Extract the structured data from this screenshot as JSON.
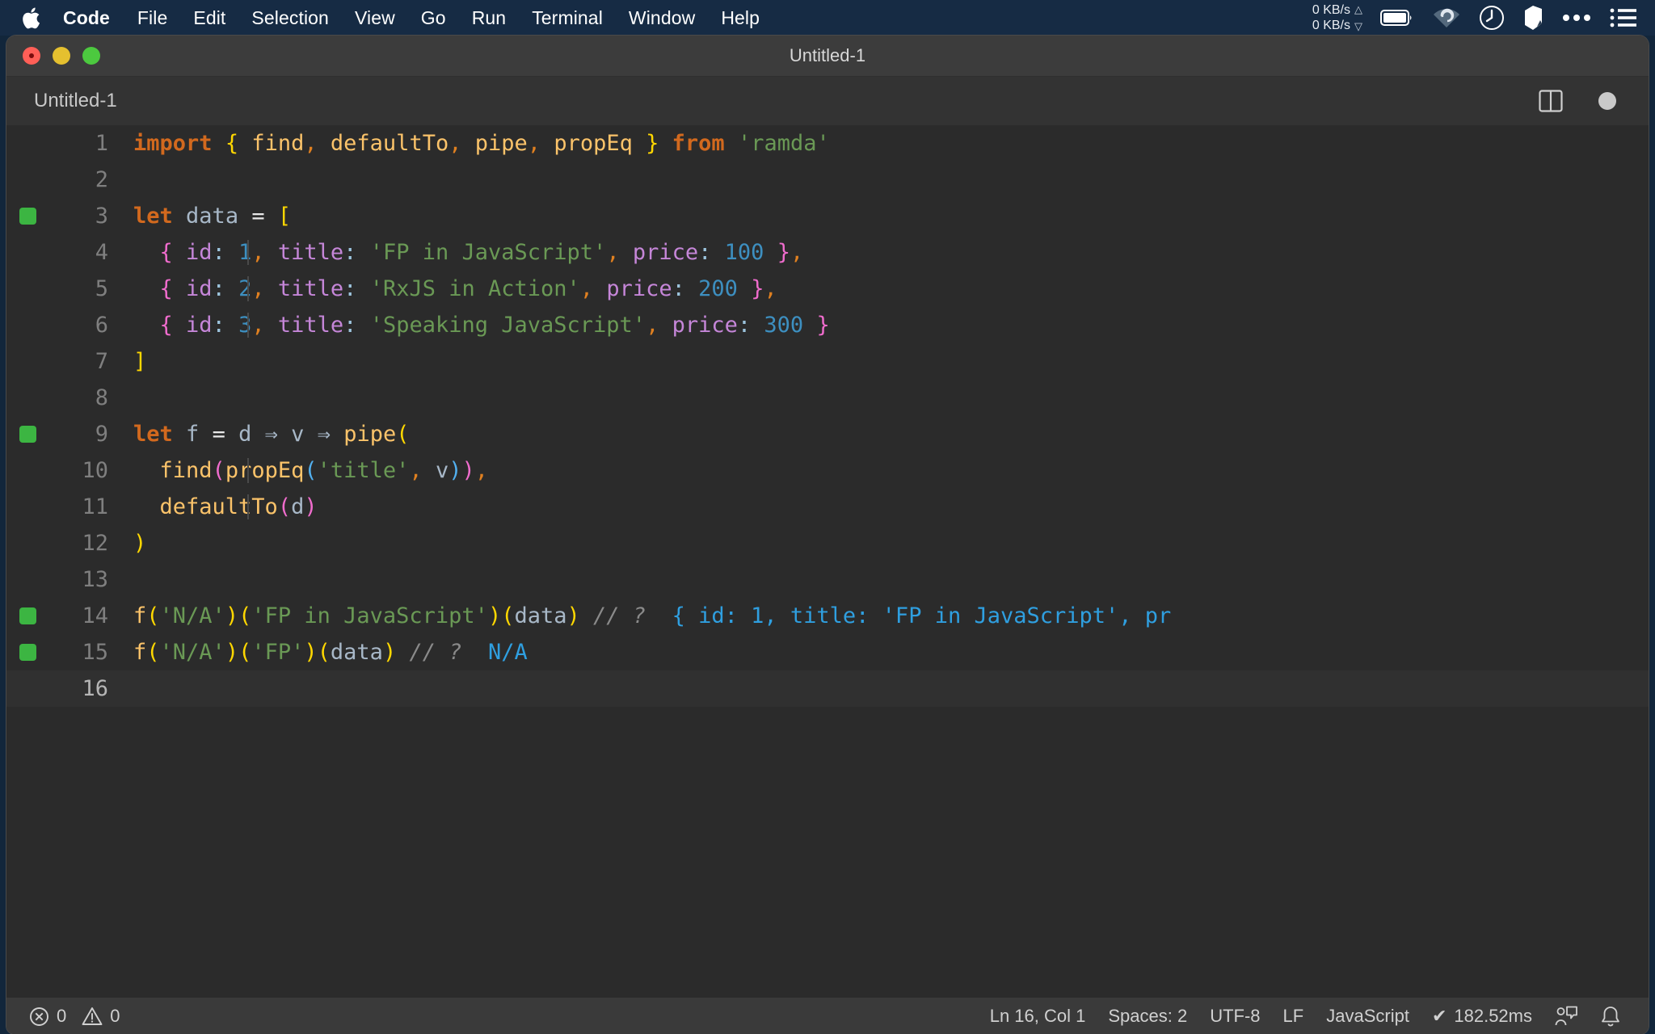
{
  "menubar": {
    "apple_icon": "apple-logo",
    "items": [
      {
        "label": "Code",
        "bold": true
      },
      {
        "label": "File",
        "bold": false
      },
      {
        "label": "Edit",
        "bold": false
      },
      {
        "label": "Selection",
        "bold": false
      },
      {
        "label": "View",
        "bold": false
      },
      {
        "label": "Go",
        "bold": false
      },
      {
        "label": "Run",
        "bold": false
      },
      {
        "label": "Terminal",
        "bold": false
      },
      {
        "label": "Window",
        "bold": false
      },
      {
        "label": "Help",
        "bold": false
      }
    ],
    "network": {
      "upload": "0 KB/s",
      "download": "0 KB/s"
    },
    "status_icons": [
      "battery-icon",
      "wifi-icon",
      "clock-icon",
      "bartender-icon",
      "ellipsis-icon",
      "list-icon"
    ]
  },
  "window": {
    "title": "Untitled-1",
    "traffic_lights": [
      "close-button",
      "minimize-button",
      "maximize-button"
    ]
  },
  "tabbar": {
    "tabs": [
      {
        "label": "Untitled-1",
        "active": true
      }
    ],
    "actions": [
      "split-editor-icon",
      "unsaved-dot-icon"
    ]
  },
  "editor": {
    "language": "JavaScript",
    "current_line": 16,
    "lines": [
      {
        "n": 1,
        "breakpoint": false,
        "indent_guide": false,
        "current": false
      },
      {
        "n": 2,
        "breakpoint": false,
        "indent_guide": false,
        "current": false
      },
      {
        "n": 3,
        "breakpoint": true,
        "indent_guide": false,
        "current": false
      },
      {
        "n": 4,
        "breakpoint": false,
        "indent_guide": true,
        "current": false
      },
      {
        "n": 5,
        "breakpoint": false,
        "indent_guide": true,
        "current": false
      },
      {
        "n": 6,
        "breakpoint": false,
        "indent_guide": true,
        "current": false
      },
      {
        "n": 7,
        "breakpoint": false,
        "indent_guide": false,
        "current": false
      },
      {
        "n": 8,
        "breakpoint": false,
        "indent_guide": false,
        "current": false
      },
      {
        "n": 9,
        "breakpoint": true,
        "indent_guide": false,
        "current": false
      },
      {
        "n": 10,
        "breakpoint": false,
        "indent_guide": true,
        "current": false
      },
      {
        "n": 11,
        "breakpoint": false,
        "indent_guide": true,
        "current": false
      },
      {
        "n": 12,
        "breakpoint": false,
        "indent_guide": false,
        "current": false
      },
      {
        "n": 13,
        "breakpoint": false,
        "indent_guide": false,
        "current": false
      },
      {
        "n": 14,
        "breakpoint": true,
        "indent_guide": false,
        "current": false
      },
      {
        "n": 15,
        "breakpoint": true,
        "indent_guide": false,
        "current": false
      },
      {
        "n": 16,
        "breakpoint": false,
        "indent_guide": false,
        "current": true
      }
    ],
    "source_text": [
      "import { find, defaultTo, pipe, propEq } from 'ramda'",
      "",
      "let data = [",
      "  { id: 1, title: 'FP in JavaScript', price: 100 },",
      "  { id: 2, title: 'RxJS in Action', price: 200 },",
      "  { id: 3, title: 'Speaking JavaScript', price: 300 }",
      "]",
      "",
      "let f = d => v => pipe(",
      "  find(propEq('title', v)),",
      "  defaultTo(d)",
      ")",
      "",
      "f('N/A')('FP in JavaScript')(data) // ? { id: 1, title: 'FP in JavaScript', pr",
      "f('N/A')('FP')(data) // ? N/A",
      ""
    ],
    "tokens": {
      "l1": [
        {
          "t": "import",
          "c": "kw"
        },
        {
          "t": " ",
          "c": "plain"
        },
        {
          "t": "{",
          "c": "br1"
        },
        {
          "t": " ",
          "c": "plain"
        },
        {
          "t": "find",
          "c": "fn"
        },
        {
          "t": ",",
          "c": "comma"
        },
        {
          "t": " ",
          "c": "plain"
        },
        {
          "t": "defaultTo",
          "c": "fn"
        },
        {
          "t": ",",
          "c": "comma"
        },
        {
          "t": " ",
          "c": "plain"
        },
        {
          "t": "pipe",
          "c": "fn"
        },
        {
          "t": ",",
          "c": "comma"
        },
        {
          "t": " ",
          "c": "plain"
        },
        {
          "t": "propEq",
          "c": "fn"
        },
        {
          "t": " ",
          "c": "plain"
        },
        {
          "t": "}",
          "c": "br1"
        },
        {
          "t": " ",
          "c": "plain"
        },
        {
          "t": "from",
          "c": "kw"
        },
        {
          "t": " ",
          "c": "plain"
        },
        {
          "t": "'ramda'",
          "c": "str"
        }
      ],
      "l3": [
        {
          "t": "let",
          "c": "kw"
        },
        {
          "t": " ",
          "c": "plain"
        },
        {
          "t": "data",
          "c": "var"
        },
        {
          "t": " ",
          "c": "plain"
        },
        {
          "t": "=",
          "c": "op"
        },
        {
          "t": " ",
          "c": "plain"
        },
        {
          "t": "[",
          "c": "br1"
        }
      ],
      "l4": [
        {
          "t": "  ",
          "c": "plain"
        },
        {
          "t": "{",
          "c": "br2"
        },
        {
          "t": " ",
          "c": "plain"
        },
        {
          "t": "id",
          "c": "prop"
        },
        {
          "t": ":",
          "c": "colon"
        },
        {
          "t": " ",
          "c": "plain"
        },
        {
          "t": "1",
          "c": "num"
        },
        {
          "t": ",",
          "c": "comma"
        },
        {
          "t": " ",
          "c": "plain"
        },
        {
          "t": "title",
          "c": "prop"
        },
        {
          "t": ":",
          "c": "colon"
        },
        {
          "t": " ",
          "c": "plain"
        },
        {
          "t": "'FP in JavaScript'",
          "c": "str"
        },
        {
          "t": ",",
          "c": "comma"
        },
        {
          "t": " ",
          "c": "plain"
        },
        {
          "t": "price",
          "c": "prop"
        },
        {
          "t": ":",
          "c": "colon"
        },
        {
          "t": " ",
          "c": "plain"
        },
        {
          "t": "100",
          "c": "num"
        },
        {
          "t": " ",
          "c": "plain"
        },
        {
          "t": "}",
          "c": "br2"
        },
        {
          "t": ",",
          "c": "comma"
        }
      ],
      "l5": [
        {
          "t": "  ",
          "c": "plain"
        },
        {
          "t": "{",
          "c": "br2"
        },
        {
          "t": " ",
          "c": "plain"
        },
        {
          "t": "id",
          "c": "prop"
        },
        {
          "t": ":",
          "c": "colon"
        },
        {
          "t": " ",
          "c": "plain"
        },
        {
          "t": "2",
          "c": "num"
        },
        {
          "t": ",",
          "c": "comma"
        },
        {
          "t": " ",
          "c": "plain"
        },
        {
          "t": "title",
          "c": "prop"
        },
        {
          "t": ":",
          "c": "colon"
        },
        {
          "t": " ",
          "c": "plain"
        },
        {
          "t": "'RxJS in Action'",
          "c": "str"
        },
        {
          "t": ",",
          "c": "comma"
        },
        {
          "t": " ",
          "c": "plain"
        },
        {
          "t": "price",
          "c": "prop"
        },
        {
          "t": ":",
          "c": "colon"
        },
        {
          "t": " ",
          "c": "plain"
        },
        {
          "t": "200",
          "c": "num"
        },
        {
          "t": " ",
          "c": "plain"
        },
        {
          "t": "}",
          "c": "br2"
        },
        {
          "t": ",",
          "c": "comma"
        }
      ],
      "l6": [
        {
          "t": "  ",
          "c": "plain"
        },
        {
          "t": "{",
          "c": "br2"
        },
        {
          "t": " ",
          "c": "plain"
        },
        {
          "t": "id",
          "c": "prop"
        },
        {
          "t": ":",
          "c": "colon"
        },
        {
          "t": " ",
          "c": "plain"
        },
        {
          "t": "3",
          "c": "num"
        },
        {
          "t": ",",
          "c": "comma"
        },
        {
          "t": " ",
          "c": "plain"
        },
        {
          "t": "title",
          "c": "prop"
        },
        {
          "t": ":",
          "c": "colon"
        },
        {
          "t": " ",
          "c": "plain"
        },
        {
          "t": "'Speaking JavaScript'",
          "c": "str"
        },
        {
          "t": ",",
          "c": "comma"
        },
        {
          "t": " ",
          "c": "plain"
        },
        {
          "t": "price",
          "c": "prop"
        },
        {
          "t": ":",
          "c": "colon"
        },
        {
          "t": " ",
          "c": "plain"
        },
        {
          "t": "300",
          "c": "num"
        },
        {
          "t": " ",
          "c": "plain"
        },
        {
          "t": "}",
          "c": "br2"
        }
      ],
      "l7": [
        {
          "t": "]",
          "c": "br1"
        }
      ],
      "l9": [
        {
          "t": "let",
          "c": "kw"
        },
        {
          "t": " ",
          "c": "plain"
        },
        {
          "t": "f",
          "c": "var"
        },
        {
          "t": " ",
          "c": "plain"
        },
        {
          "t": "=",
          "c": "op"
        },
        {
          "t": " ",
          "c": "plain"
        },
        {
          "t": "d",
          "c": "var"
        },
        {
          "t": " ",
          "c": "plain"
        },
        {
          "t": "⇒",
          "c": "arrow"
        },
        {
          "t": " ",
          "c": "plain"
        },
        {
          "t": "v",
          "c": "var"
        },
        {
          "t": " ",
          "c": "plain"
        },
        {
          "t": "⇒",
          "c": "arrow"
        },
        {
          "t": " ",
          "c": "plain"
        },
        {
          "t": "pipe",
          "c": "fn"
        },
        {
          "t": "(",
          "c": "br1"
        }
      ],
      "l10": [
        {
          "t": "  ",
          "c": "plain"
        },
        {
          "t": "find",
          "c": "fn"
        },
        {
          "t": "(",
          "c": "br2"
        },
        {
          "t": "propEq",
          "c": "fn"
        },
        {
          "t": "(",
          "c": "br3"
        },
        {
          "t": "'title'",
          "c": "str"
        },
        {
          "t": ",",
          "c": "comma"
        },
        {
          "t": " ",
          "c": "plain"
        },
        {
          "t": "v",
          "c": "var"
        },
        {
          "t": ")",
          "c": "br3"
        },
        {
          "t": ")",
          "c": "br2"
        },
        {
          "t": ",",
          "c": "comma"
        }
      ],
      "l11": [
        {
          "t": "  ",
          "c": "plain"
        },
        {
          "t": "defaultTo",
          "c": "fn"
        },
        {
          "t": "(",
          "c": "br2"
        },
        {
          "t": "d",
          "c": "var"
        },
        {
          "t": ")",
          "c": "br2"
        }
      ],
      "l12": [
        {
          "t": ")",
          "c": "br1"
        }
      ],
      "l14": [
        {
          "t": "f",
          "c": "fn"
        },
        {
          "t": "(",
          "c": "br1"
        },
        {
          "t": "'N/A'",
          "c": "str"
        },
        {
          "t": ")",
          "c": "br1"
        },
        {
          "t": "(",
          "c": "br1"
        },
        {
          "t": "'FP in JavaScript'",
          "c": "str"
        },
        {
          "t": ")",
          "c": "br1"
        },
        {
          "t": "(",
          "c": "br1"
        },
        {
          "t": "data",
          "c": "var"
        },
        {
          "t": ")",
          "c": "br1"
        },
        {
          "t": " ",
          "c": "plain"
        },
        {
          "t": "// ?",
          "c": "comment"
        },
        {
          "t": "  ",
          "c": "plain"
        },
        {
          "t": "{ id: 1, title: 'FP in JavaScript', pr",
          "c": "result"
        }
      ],
      "l15": [
        {
          "t": "f",
          "c": "fn"
        },
        {
          "t": "(",
          "c": "br1"
        },
        {
          "t": "'N/A'",
          "c": "str"
        },
        {
          "t": ")",
          "c": "br1"
        },
        {
          "t": "(",
          "c": "br1"
        },
        {
          "t": "'FP'",
          "c": "str"
        },
        {
          "t": ")",
          "c": "br1"
        },
        {
          "t": "(",
          "c": "br1"
        },
        {
          "t": "data",
          "c": "var"
        },
        {
          "t": ")",
          "c": "br1"
        },
        {
          "t": " ",
          "c": "plain"
        },
        {
          "t": "// ?",
          "c": "comment"
        },
        {
          "t": "  ",
          "c": "plain"
        },
        {
          "t": "N/A",
          "c": "result"
        }
      ]
    }
  },
  "statusbar": {
    "errors": "0",
    "warnings": "0",
    "cursor_position": "Ln 16, Col 1",
    "indentation": "Spaces: 2",
    "encoding": "UTF-8",
    "eol": "LF",
    "language": "JavaScript",
    "runtime": "182.52ms",
    "runtime_check": "✔",
    "right_icons": [
      "feedback-icon",
      "bell-icon"
    ]
  },
  "colors": {
    "menubar_bg": "#162b44",
    "titlebar_bg": "#3c3c3c",
    "editor_bg": "#2b2b2b",
    "statusbar_bg": "#3a3a3a",
    "breakpoint_green": "#3cb542",
    "result_blue": "#2f9fe0"
  }
}
